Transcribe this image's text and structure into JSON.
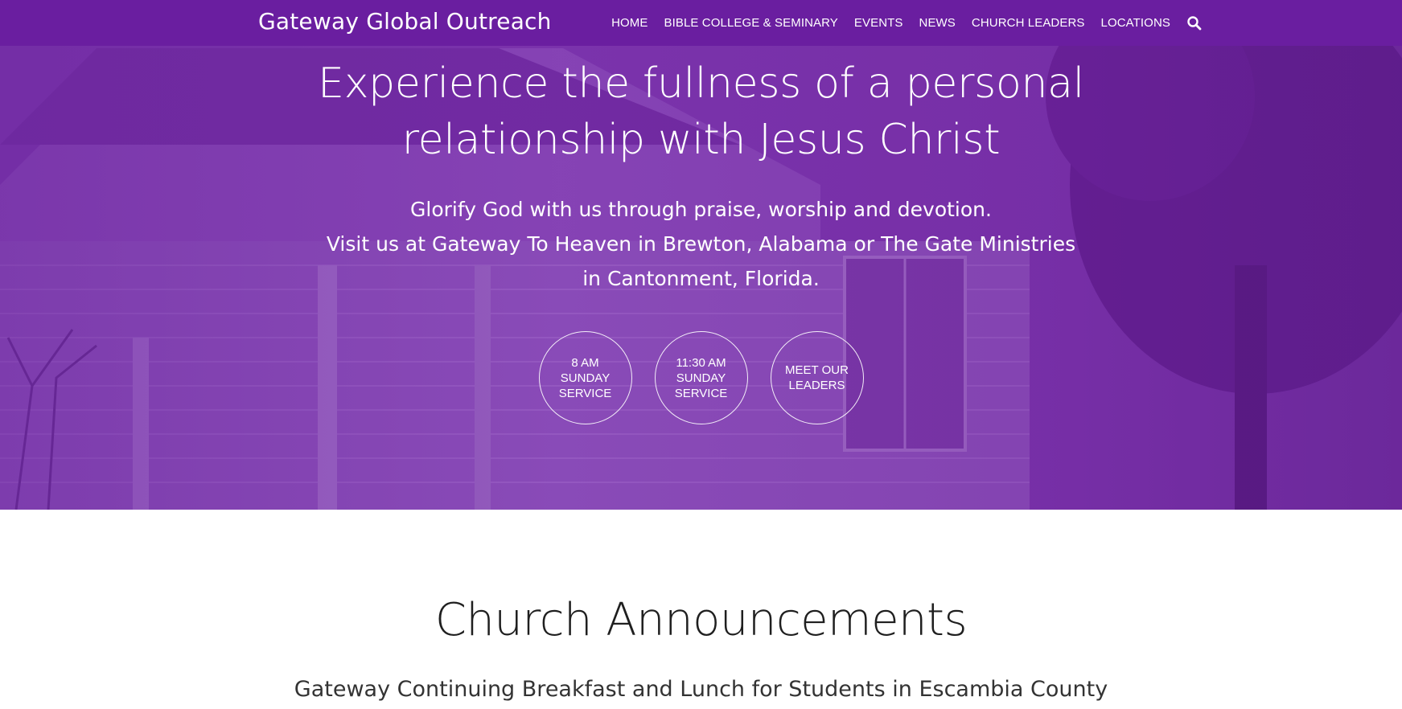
{
  "header": {
    "brand": "Gateway Global Outreach",
    "nav": [
      {
        "label": "HOME"
      },
      {
        "label": "BIBLE COLLEGE & SEMINARY"
      },
      {
        "label": "EVENTS"
      },
      {
        "label": "NEWS"
      },
      {
        "label": "CHURCH LEADERS"
      },
      {
        "label": "LOCATIONS"
      }
    ],
    "search_icon": "search-icon"
  },
  "hero": {
    "headline_line1": "Experience the fullness of a personal",
    "headline_line2": "relationship with Jesus Christ",
    "subtext_line1": "Glorify God with us through praise, worship and devotion.",
    "subtext_line2": "Visit us at Gateway To Heaven in Brewton, Alabama or The Gate Ministries",
    "subtext_line3": "in Cantonment, Florida.",
    "buttons": [
      {
        "line1": "8 AM",
        "line2": "SUNDAY",
        "line3": "SERVICE"
      },
      {
        "line1": "11:30 AM",
        "line2": "SUNDAY",
        "line3": "SERVICE"
      },
      {
        "line1": "MEET OUR",
        "line2": "LEADERS",
        "line3": ""
      }
    ],
    "overlay_color": "#7a2fb0"
  },
  "announcements": {
    "title": "Church Announcements",
    "items": [
      {
        "text": "Gateway Continuing Breakfast and Lunch for Students in Escambia County"
      }
    ]
  }
}
